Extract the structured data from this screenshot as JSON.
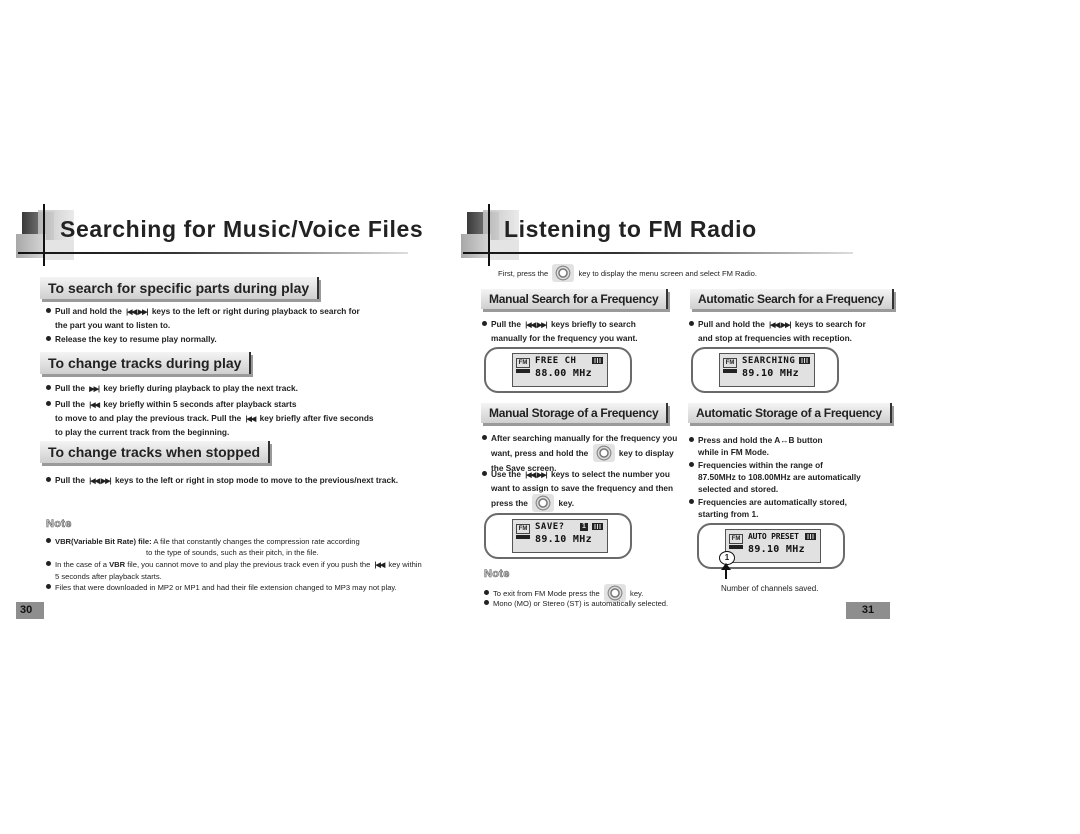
{
  "left_page": {
    "title": "Searching for Music/Voice Files",
    "page_number": "30",
    "sections": [
      {
        "heading": "To search for specific parts during play",
        "bullets": [
          {
            "pre": "Pull and hold the",
            "keys": "|◀◀, ▶▶|",
            "post": "keys to the left or right during playback to search for",
            "cont": "the part you want to listen to."
          },
          {
            "pre": "Release the key to resume play normally."
          }
        ]
      },
      {
        "heading": "To change tracks during play",
        "bullets": [
          {
            "pre": "Pull the",
            "keys": "▶▶|",
            "post": "key briefly during playback to play the next track."
          },
          {
            "pre": "Pull the",
            "keys": "|◀◀",
            "post": "key briefly within 5 seconds after playback starts",
            "cont": "to move to and play the previous track. Pull the",
            "cont_keys": "|◀◀",
            "cont_post": "key briefly after five seconds",
            "cont2": "to play the current track from the beginning."
          }
        ]
      },
      {
        "heading": "To change tracks when stopped",
        "bullets": [
          {
            "pre": "Pull the",
            "keys": "|◀◀, ▶▶|",
            "post": "keys to the left or right in stop mode to move to the previous/next track."
          }
        ]
      }
    ],
    "note": {
      "title": "Note",
      "items": [
        {
          "bold": "VBR(Variable Bit Rate) file:",
          "text": "A file that constantly changes the compression rate according",
          "cont": "to the type of sounds, such as their pitch, in the file."
        },
        {
          "pre": "In the case of a",
          "bold": "VBR",
          "text": "file, you cannot move to and play the previous track even if you push the",
          "keys": "|◀◀",
          "post": "key within",
          "cont": "5 seconds after playback starts."
        },
        {
          "text": "Files that were downloaded in MP2 or MP1 and had their file extension changed to MP3 may not play."
        }
      ]
    }
  },
  "right_page": {
    "title": "Listening to FM Radio",
    "page_number": "31",
    "intro": {
      "pre": "First, press the",
      "post": "key to display the menu screen and select FM Radio."
    },
    "manual_search": {
      "heading": "Manual Search for a Frequency",
      "bullet": {
        "pre": "Pull the",
        "keys": "|◀◀, ▶▶|",
        "post": "keys briefly to search",
        "cont": "manually for the frequency you want."
      },
      "lcd": {
        "fm": "FM",
        "line1": "FREE  CH",
        "line2": "88.00 MHz"
      }
    },
    "auto_search": {
      "heading": "Automatic Search for a Frequency",
      "bullet": {
        "pre": "Pull and hold the",
        "keys": "|◀◀, ▶▶|",
        "post": "keys to search for",
        "cont": "and stop at frequencies with reception."
      },
      "lcd": {
        "fm": "FM",
        "line1": "SEARCHING",
        "line2": "89.10 MHz"
      }
    },
    "manual_storage": {
      "heading": "Manual Storage of a Frequency",
      "bullets": [
        {
          "l1": "After searching manually for the frequency you",
          "l2_pre": "want, press and hold the",
          "l2_post": "key to display",
          "l3": "the Save screen."
        },
        {
          "l1_pre": "Use the",
          "keys": "|◀◀, ▶▶|",
          "l1_post": "keys to select the number you",
          "l2": "want to assign to save the frequency and then",
          "l3_pre": "press the",
          "l3_post": "key."
        }
      ],
      "lcd": {
        "fm": "FM",
        "line1": "SAVE?",
        "channel": "1",
        "line2": "89.10 MHz"
      }
    },
    "auto_storage": {
      "heading": "Automatic Storage of a Frequency",
      "bullets": [
        {
          "l1": "Press and hold the A↔B button",
          "l2": "while in FM Mode."
        },
        {
          "l1": "Frequencies within the range of",
          "l2": "87.50MHz to 108.00MHz are automatically",
          "l3": "selected and stored."
        },
        {
          "l1": "Frequencies are automatically stored,",
          "l2": "starting from 1."
        }
      ],
      "lcd": {
        "fm": "FM",
        "line1": "AUTO PRESET",
        "line2": "89.10 MHz",
        "channel": "1"
      },
      "caption": "Number of channels saved."
    },
    "note": {
      "title": "Note",
      "items": [
        {
          "pre": "To exit from FM Mode press the",
          "post": "key."
        },
        {
          "text": "Mono (MO) or Stereo (ST) is automatically selected."
        }
      ]
    }
  }
}
